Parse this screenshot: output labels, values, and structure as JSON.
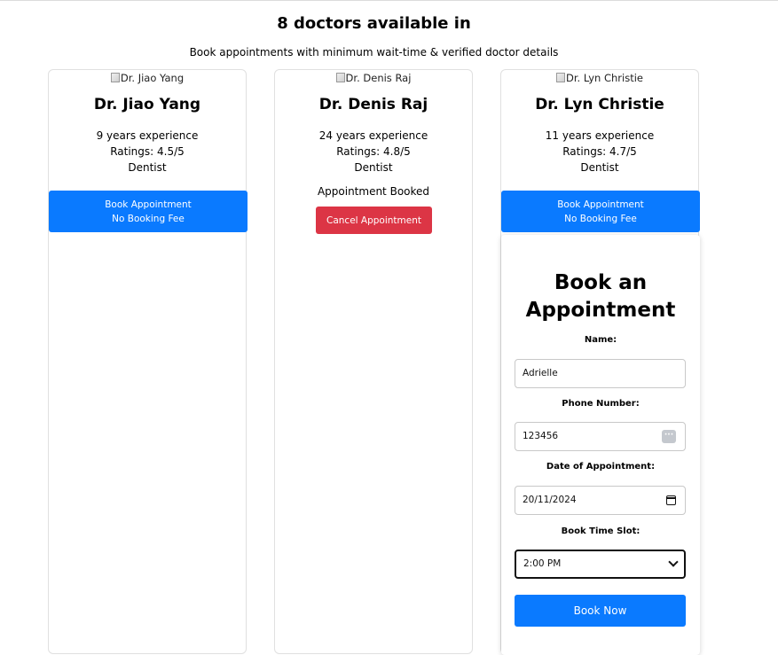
{
  "header": {
    "title": "8 doctors available in",
    "subtitle": "Book appointments with minimum wait-time & verified doctor details"
  },
  "doctors": [
    {
      "image_alt": "Dr. Jiao Yang",
      "name": "Dr. Jiao Yang",
      "experience": "9 years experience",
      "rating": "Ratings: 4.5/5",
      "specialty": "Dentist",
      "book_label_line1": "Book Appointment",
      "book_label_line2": "No Booking Fee"
    },
    {
      "image_alt": "Dr. Denis Raj",
      "name": "Dr. Denis Raj",
      "experience": "24 years experience",
      "rating": "Ratings: 4.8/5",
      "specialty": "Dentist",
      "status_text": "Appointment Booked",
      "cancel_label": "Cancel Appointment"
    },
    {
      "image_alt": "Dr. Lyn Christie",
      "name": "Dr. Lyn Christie",
      "experience": "11 years experience",
      "rating": "Ratings: 4.7/5",
      "specialty": "Dentist",
      "book_label_line1": "Book Appointment",
      "book_label_line2": "No Booking Fee"
    }
  ],
  "booking_form": {
    "title": "Book an Appointment",
    "name_label": "Name:",
    "name_value": "Adrielle",
    "phone_label": "Phone Number:",
    "phone_value": "123456",
    "phone_icon": "ellipsis-autofill-icon",
    "date_label": "Date of Appointment:",
    "date_value": "20/11/2024",
    "date_icon": "calendar-icon",
    "slot_label": "Book Time Slot:",
    "slot_value": "2:00 PM",
    "slot_icon": "chevron-down-icon",
    "submit_label": "Book Now"
  },
  "colors": {
    "primary_button": "#0a7aff",
    "cancel_button": "#dc3545"
  }
}
